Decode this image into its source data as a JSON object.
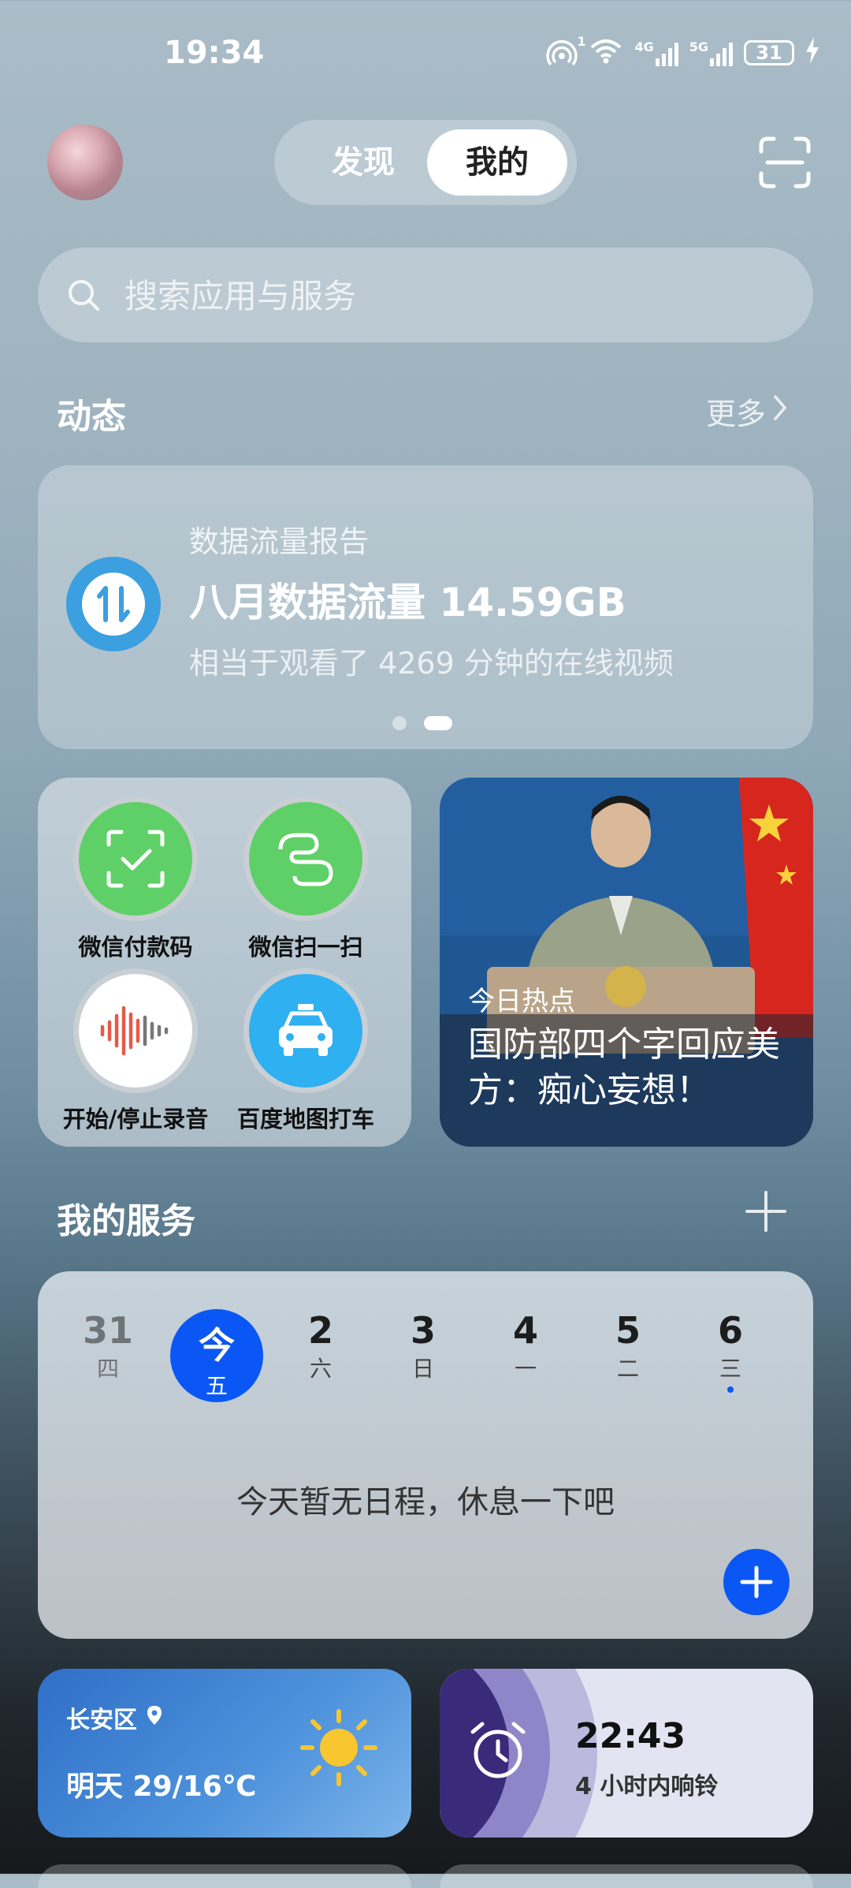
{
  "status_bar": {
    "time": "19:34",
    "network_1": "4G",
    "network_2": "5G",
    "hotspot_badge": "1",
    "battery": "31"
  },
  "header": {
    "tabs": [
      "发现",
      "我的"
    ],
    "active_tab": "我的"
  },
  "search": {
    "placeholder": "搜索应用与服务"
  },
  "dynamics": {
    "title": "动态",
    "more": "更多",
    "card": {
      "subtitle": "数据流量报告",
      "headline": "八月数据流量 14.59GB",
      "description": "相当于观看了 4269 分钟的在线视频"
    }
  },
  "shortcuts": [
    {
      "label": "微信付款码",
      "icon": "wechat-pay-code-icon",
      "color": "#5fd067"
    },
    {
      "label": "微信扫一扫",
      "icon": "wechat-scan-icon",
      "color": "#5fd067"
    },
    {
      "label": "开始/停止录音",
      "icon": "sound-wave-icon",
      "color": "#ffffff"
    },
    {
      "label": "百度地图打车",
      "icon": "taxi-icon",
      "color": "#2fb0f0"
    }
  ],
  "news": {
    "kicker": "今日热点",
    "headline": "国防部四个字回应美方：痴心妄想！"
  },
  "services": {
    "title": "我的服务",
    "calendar": {
      "days": [
        {
          "num": "31",
          "week": "四",
          "state": "past"
        },
        {
          "num": "今",
          "week": "五",
          "state": "today"
        },
        {
          "num": "2",
          "week": "六",
          "state": "future"
        },
        {
          "num": "3",
          "week": "日",
          "state": "future"
        },
        {
          "num": "4",
          "week": "一",
          "state": "future"
        },
        {
          "num": "5",
          "week": "二",
          "state": "future"
        },
        {
          "num": "6",
          "week": "三",
          "state": "future",
          "has_event": true
        }
      ],
      "empty_text": "今天暂无日程，休息一下吧"
    }
  },
  "weather": {
    "location": "长安区",
    "forecast": "明天 29/16℃"
  },
  "alarm": {
    "time": "22:43",
    "description": "4 小时内响铃"
  },
  "colors": {
    "accent": "#0a57f5",
    "wechat_green": "#5fd067",
    "data_blue": "#3b9fe0"
  }
}
